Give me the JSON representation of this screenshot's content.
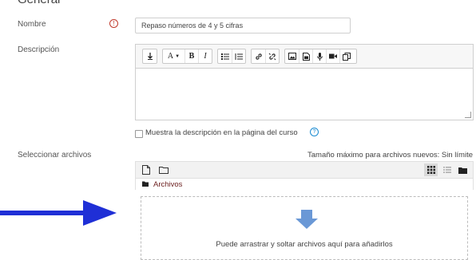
{
  "section": {
    "title": "General"
  },
  "name_field": {
    "label": "Nombre",
    "value": "Repaso números de 4 y 5 cifras"
  },
  "description_field": {
    "label": "Descripción",
    "text": ""
  },
  "toolbar": {
    "buttons": [
      {
        "name": "toolbar-toggle-button",
        "icon": "↧"
      },
      {
        "name": "font-style-button",
        "icon": "A ▾"
      },
      {
        "name": "bold-button",
        "icon": "B"
      },
      {
        "name": "italic-button",
        "icon": "I"
      },
      {
        "name": "unordered-list-button",
        "icon": "ul"
      },
      {
        "name": "ordered-list-button",
        "icon": "ol"
      },
      {
        "name": "link-button",
        "icon": "link"
      },
      {
        "name": "unlink-button",
        "icon": "unlink"
      },
      {
        "name": "image-button",
        "icon": "image"
      },
      {
        "name": "media-button",
        "icon": "media"
      },
      {
        "name": "record-audio-button",
        "icon": "mic"
      },
      {
        "name": "record-video-button",
        "icon": "video"
      },
      {
        "name": "manage-files-button",
        "icon": "files"
      }
    ]
  },
  "show_description": {
    "label": "Muestra la descripción en la página del curso",
    "checked": false
  },
  "file_picker": {
    "label": "Seleccionar archivos",
    "max_size": "Tamaño máximo para archivos nuevos: Sin límite",
    "path": "Archivos",
    "drop_text": "Puede arrastrar y soltar archivos aquí para añadirlos"
  },
  "colors": {
    "arrow": "#1f2fd6",
    "drop_arrow": "#6a98d6",
    "required": "#c0392b",
    "help": "#1a8bd1"
  }
}
